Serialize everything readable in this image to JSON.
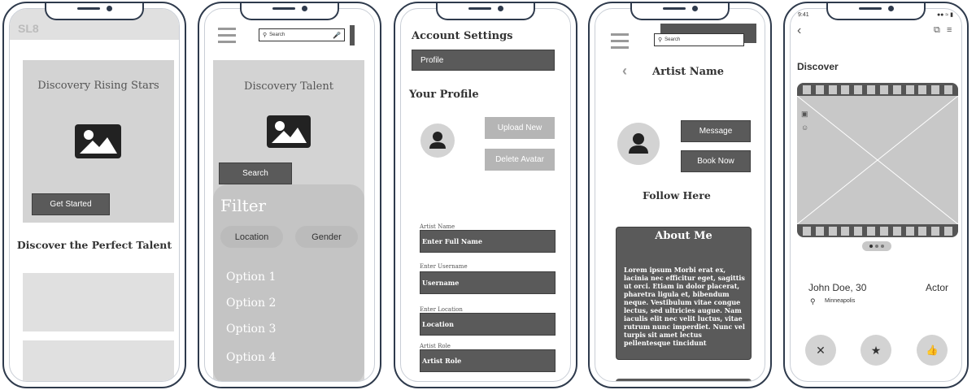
{
  "screen1": {
    "logo": "SL8",
    "hero_title": "Discovery Rising Stars",
    "get_started": "Get Started",
    "section_title": "Discover the Perfect Talent"
  },
  "screen2": {
    "search_placeholder": "Search",
    "hero_title": "Discovery Talent",
    "search_button": "Search",
    "filter_title": "Filter",
    "location": "Location",
    "gender": "Gender",
    "options": [
      "Option 1",
      "Option 2",
      "Option 3",
      "Option 4"
    ]
  },
  "screen3": {
    "title": "Account Settings",
    "profile_tab": "Profile",
    "section_title": "Your Profile",
    "upload_new": "Upload New",
    "delete_avatar": "Delete Avatar",
    "fields": [
      {
        "label": "Artist Name",
        "value": "Enter Full Name"
      },
      {
        "label": "Enter Username",
        "value": "Username"
      },
      {
        "label": "Enter Location",
        "value": "Location"
      },
      {
        "label": "Artist Role",
        "value": "Artist Role"
      }
    ]
  },
  "screen4": {
    "search_placeholder": "Search",
    "artist_name": "Artist Name",
    "message": "Message",
    "book_now": "Book Now",
    "follow": "Follow Here",
    "about_title": "About Me",
    "about_text": "Lorem ipsum Morbi erat ex, lacinia nec efficitur eget, sagittis ut orci. Etiam in dolor placerat, pharetra ligula et, bibendum neque. Vestibulum vitae congue lectus, sed ultricies augue. Nam iaculis elit nec velit luctus, vitae rutrum nunc imperdiet. Nunc vel turpis sit amet lectus pellentesque tincidunt"
  },
  "screen5": {
    "time": "9:41",
    "title": "Discover",
    "name": "John Doe, 30",
    "role": "Actor",
    "location": "Minneapolis"
  },
  "colors": {
    "frame": "#2e3a4c",
    "dark_button": "#5a5a5a",
    "light_panel": "#d3d3d3"
  }
}
